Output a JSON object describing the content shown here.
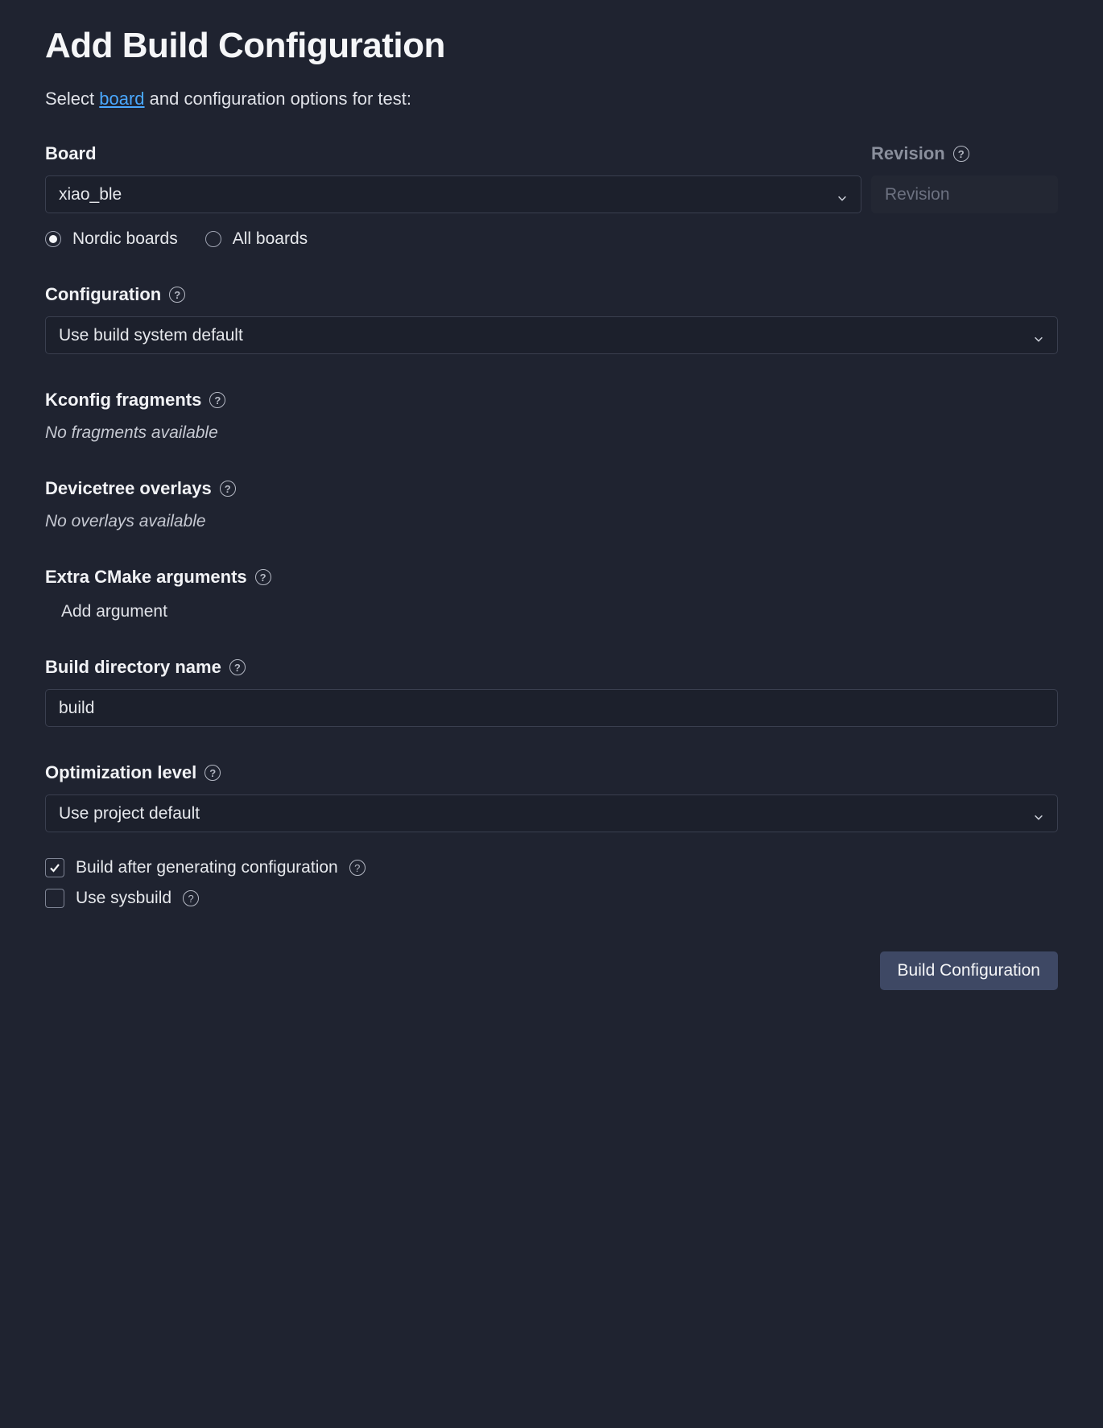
{
  "title": "Add Build Configuration",
  "intro": {
    "prefix": "Select ",
    "link": "board",
    "suffix": " and configuration options for test:"
  },
  "board": {
    "label": "Board",
    "value": "xiao_ble",
    "filter": {
      "nordic": "Nordic boards",
      "all": "All boards",
      "selected": "nordic"
    }
  },
  "revision": {
    "label": "Revision",
    "placeholder": "Revision",
    "value": ""
  },
  "configuration": {
    "label": "Configuration",
    "value": "Use build system default"
  },
  "kconfig": {
    "label": "Kconfig fragments",
    "empty": "No fragments available"
  },
  "overlays": {
    "label": "Devicetree overlays",
    "empty": "No overlays available"
  },
  "cmake": {
    "label": "Extra CMake arguments",
    "add": "Add argument"
  },
  "build_dir": {
    "label": "Build directory name",
    "value": "build"
  },
  "optimization": {
    "label": "Optimization level",
    "value": "Use project default"
  },
  "checks": {
    "build_after": {
      "label": "Build after generating configuration",
      "checked": true
    },
    "sysbuild": {
      "label": "Use sysbuild",
      "checked": false
    }
  },
  "submit": "Build Configuration"
}
